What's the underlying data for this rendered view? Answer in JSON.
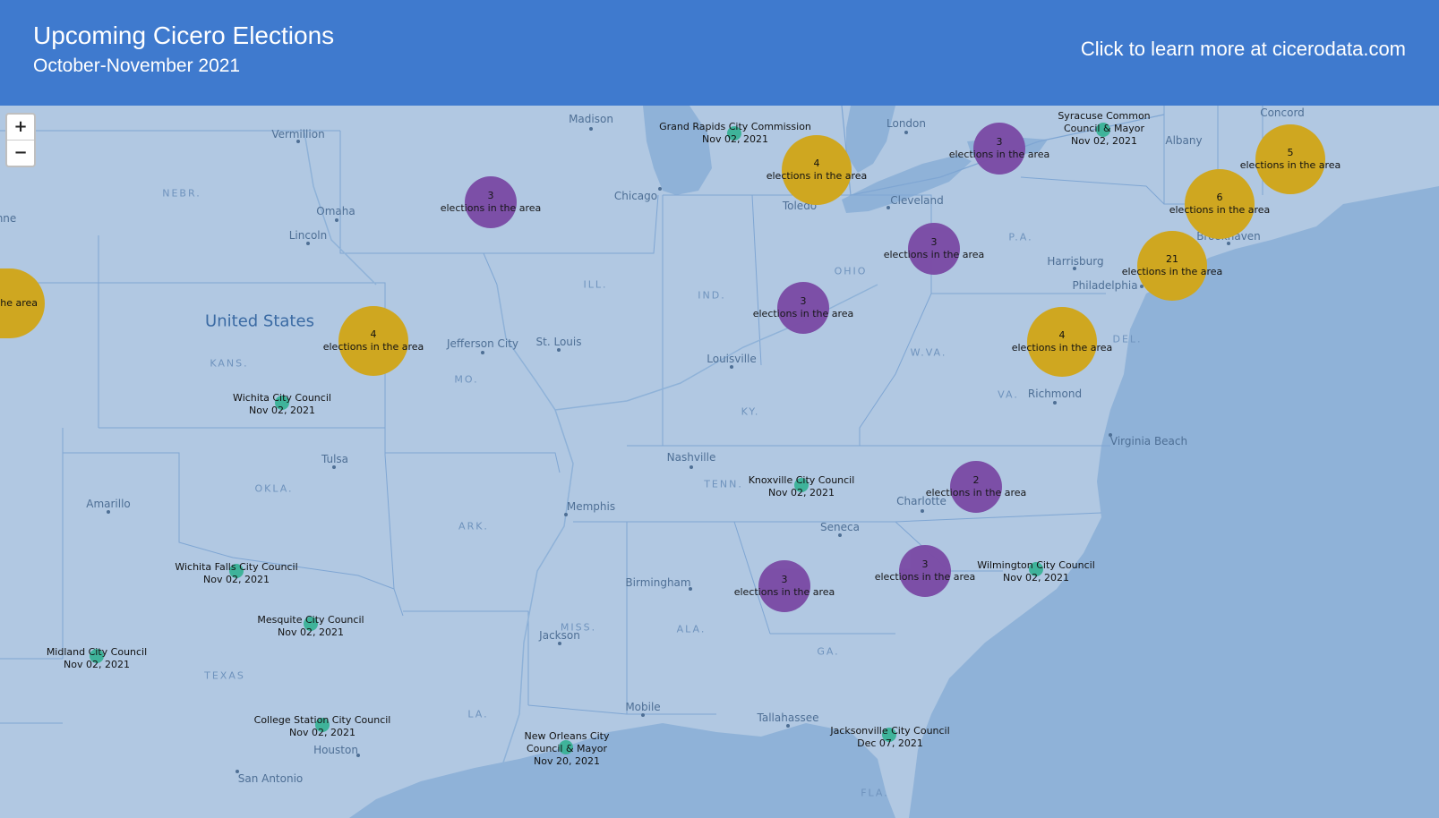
{
  "header": {
    "title": "Upcoming Cicero Elections",
    "subtitle": "October-November 2021",
    "link_text": "Click to learn more at cicerodata.com"
  },
  "colors": {
    "header_bg": "#3f7ace",
    "land": "#b1c8e2",
    "water": "#8fb2d8",
    "cluster_small": "#7b4ca6",
    "cluster_large": "#cfa720",
    "election_marker": "#3fb39a"
  },
  "zoom": {
    "in_label": "+",
    "out_label": "−"
  },
  "map": {
    "country_label": "United States",
    "state_labels": [
      "NEBR.",
      "KANS.",
      "OKLA.",
      "TEXAS",
      "MO.",
      "ARK.",
      "LA.",
      "ILL.",
      "IND.",
      "OHIO",
      "KY.",
      "TENN.",
      "MISS.",
      "ALA.",
      "GA.",
      "FLA.",
      "W.VA.",
      "VA.",
      "P.A.",
      "DEL."
    ],
    "city_labels": [
      "Vermillion",
      "Omaha",
      "Lincoln",
      "Madison",
      "Chicago",
      "Toledo",
      "Cleveland",
      "London",
      "Albany",
      "Concord",
      "Brookhaven",
      "Harrisburg",
      "Philadelphia",
      "Richmond",
      "Virginia Beach",
      "Jefferson City",
      "St. Louis",
      "Louisville",
      "Nashville",
      "Memphis",
      "Tulsa",
      "Amarillo",
      "Charlotte",
      "Seneca",
      "Birmingham",
      "Jackson",
      "Mobile",
      "Tallahassee",
      "Houston",
      "San Antonio",
      "nne"
    ]
  },
  "clusters": [
    {
      "count": "3",
      "caption": "elections in the area",
      "size": "small"
    },
    {
      "count": "4",
      "caption": "elections in the area",
      "size": "large"
    },
    {
      "count": "3",
      "caption": "elections in the area",
      "size": "small"
    },
    {
      "count": "5",
      "caption": "elections in the area",
      "size": "large"
    },
    {
      "count": "6",
      "caption": "elections in the area",
      "size": "large"
    },
    {
      "count": "3",
      "caption": "elections in the area",
      "size": "small"
    },
    {
      "count": "21",
      "caption": "elections in the area",
      "size": "large"
    },
    {
      "count": "3",
      "caption": "elections in the area",
      "size": "small"
    },
    {
      "count": "4",
      "caption": "elections in the area",
      "size": "large"
    },
    {
      "count": "4",
      "caption": "elections in the area",
      "size": "large"
    },
    {
      "count": "2",
      "caption": "elections in the area",
      "size": "small"
    },
    {
      "count": "3",
      "caption": "elections in the area",
      "size": "small"
    },
    {
      "count": "3",
      "caption": "elections in the area",
      "size": "small"
    },
    {
      "count": "",
      "caption": "he area",
      "size": "large"
    }
  ],
  "elections": [
    {
      "name": "Grand Rapids City Commission",
      "date": "Nov 02, 2021"
    },
    {
      "name": "Syracuse Common Council & Mayor",
      "date": "Nov 02, 2021"
    },
    {
      "name": "Wichita City Council",
      "date": "Nov 02, 2021"
    },
    {
      "name": "Knoxville City Council",
      "date": "Nov 02, 2021"
    },
    {
      "name": "Wilmington City Council",
      "date": "Nov 02, 2021"
    },
    {
      "name": "Wichita Falls City Council",
      "date": "Nov 02, 2021"
    },
    {
      "name": "Mesquite City Council",
      "date": "Nov 02, 2021"
    },
    {
      "name": "Midland City Council",
      "date": "Nov 02, 2021"
    },
    {
      "name": "College Station City Council",
      "date": "Nov 02, 2021"
    },
    {
      "name": "New Orleans City Council & Mayor",
      "date": "Nov 20, 2021"
    },
    {
      "name": "Jacksonville City Council",
      "date": "Dec 07, 2021"
    }
  ]
}
